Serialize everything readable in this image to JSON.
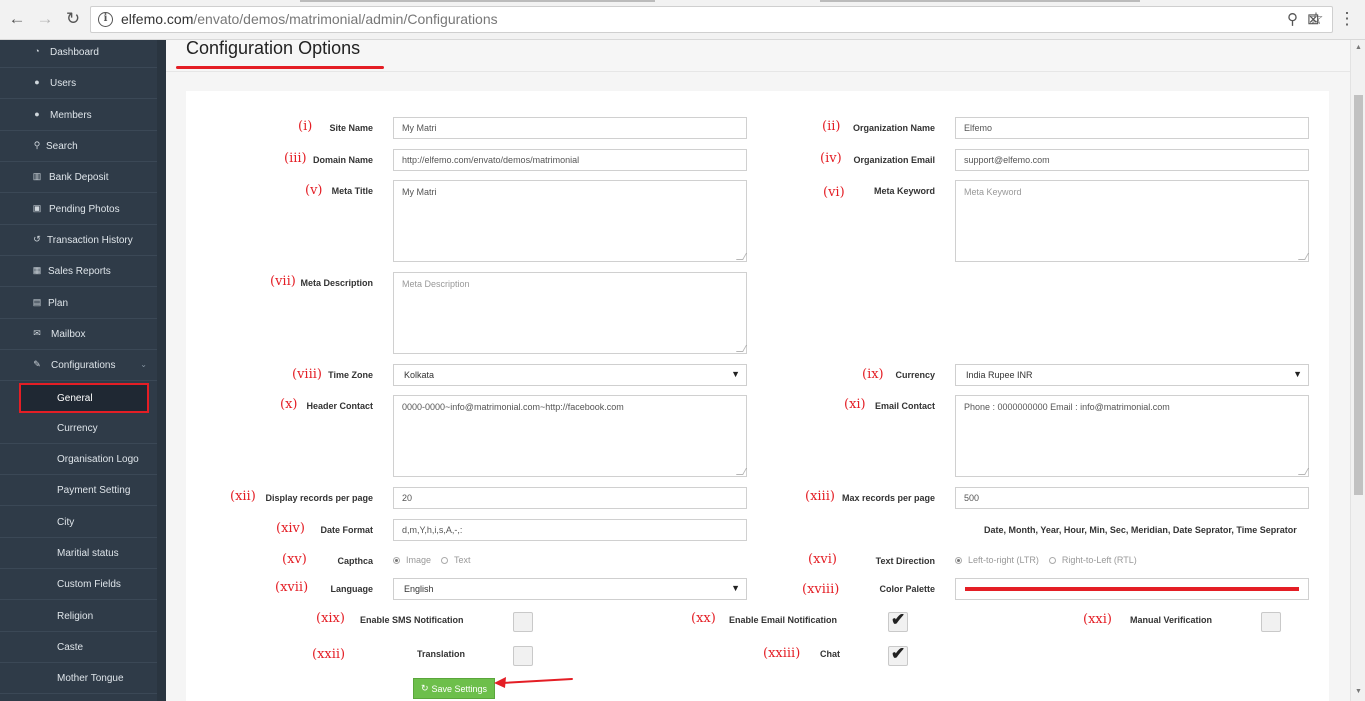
{
  "browser": {
    "url_host": "elfemo.com",
    "url_path": "/envato/demos/matrimonial/admin/Configurations",
    "back_icon": "←",
    "forward_icon": "→",
    "reload_icon": "↻",
    "info_icon": "i",
    "zoom_icon": "⚲",
    "translate_icon": "⊠",
    "star_icon": "☆",
    "menu_icon": "⋮"
  },
  "sidebar": {
    "items": [
      {
        "icon": "◔",
        "label": "Dashboard"
      },
      {
        "icon": "●",
        "label": "Users"
      },
      {
        "icon": "●",
        "label": "Members"
      },
      {
        "icon": "⚲",
        "label": "Search"
      },
      {
        "icon": "▥",
        "label": "Bank Deposit"
      },
      {
        "icon": "▣",
        "label": "Pending Photos"
      },
      {
        "icon": "↺",
        "label": "Transaction History"
      },
      {
        "icon": "▦",
        "label": "Sales Reports"
      },
      {
        "icon": "▤",
        "label": "Plan"
      },
      {
        "icon": "✉",
        "label": "Mailbox"
      },
      {
        "icon": "✎",
        "label": "Configurations"
      }
    ],
    "config_chevron": "⌄",
    "sub_items": [
      "General",
      "Currency",
      "Organisation Logo",
      "Payment Setting",
      "City",
      "Maritial status",
      "Custom Fields",
      "Religion",
      "Caste",
      "Mother Tongue"
    ]
  },
  "page": {
    "title": "Configuration Options"
  },
  "form": {
    "site_name": {
      "num": "(i)",
      "label": "Site Name",
      "value": "My Matri"
    },
    "org_name": {
      "num": "(ii)",
      "label": "Organization Name",
      "value": "Elfemo"
    },
    "domain_name": {
      "num": "(iii)",
      "label": "Domain Name",
      "value": "http://elfemo.com/envato/demos/matrimonial"
    },
    "org_email": {
      "num": "(iv)",
      "label": "Organization Email",
      "value": "support@elfemo.com"
    },
    "meta_title": {
      "num": "(v)",
      "label": "Meta Title",
      "value": "My Matri"
    },
    "meta_keyword": {
      "num": "(vi)",
      "label": "Meta Keyword",
      "placeholder": "Meta Keyword"
    },
    "meta_desc": {
      "num": "(vii)",
      "label": "Meta Description",
      "placeholder": "Meta Description"
    },
    "time_zone": {
      "num": "(viii)",
      "label": "Time Zone",
      "value": "Kolkata"
    },
    "currency": {
      "num": "(ix)",
      "label": "Currency",
      "value": "India Rupee INR"
    },
    "header_contact": {
      "num": "(x)",
      "label": "Header Contact",
      "value": "0000-0000~info@matrimonial.com~http://facebook.com"
    },
    "email_contact": {
      "num": "(xi)",
      "label": "Email Contact",
      "value": "Phone : 0000000000 Email : info@matrimonial.com"
    },
    "display_records": {
      "num": "(xii)",
      "label": "Display records per page",
      "value": "20"
    },
    "max_records": {
      "num": "(xiii)",
      "label": "Max records per page",
      "value": "500"
    },
    "date_format": {
      "num": "(xiv)",
      "label": "Date Format",
      "value": "d,m,Y,h,i,s,A,-,:",
      "hint": "Date, Month, Year, Hour, Min, Sec, Meridian, Date Seprator, Time Seprator"
    },
    "captcha": {
      "num": "(xv)",
      "label": "Capthca",
      "opt1": "Image",
      "opt2": "Text"
    },
    "text_direction": {
      "num": "(xvi)",
      "label": "Text Direction",
      "opt1": "Left-to-right (LTR)",
      "opt2": "Right-to-Left (RTL)"
    },
    "language": {
      "num": "(xvii)",
      "label": "Language",
      "value": "English"
    },
    "color_palette": {
      "num": "(xviii)",
      "label": "Color Palette",
      "color": "#e41e25"
    },
    "sms_notification": {
      "num": "(xix)",
      "label": "Enable SMS Notification",
      "checked": false
    },
    "email_notification": {
      "num": "(xx)",
      "label": "Enable Email Notification",
      "checked": true
    },
    "manual_verification": {
      "num": "(xxi)",
      "label": "Manual Verification",
      "checked": false
    },
    "translation": {
      "num": "(xxii)",
      "label": "Translation",
      "checked": false
    },
    "chat": {
      "num": "(xxiii)",
      "label": "Chat",
      "checked": true
    },
    "save_label": "Save Settings",
    "save_icon": "↻",
    "select_arrow": "▼",
    "check_mark": "✔"
  },
  "colors": {
    "accent": "#e41e25",
    "sidebar": "#2f3b48",
    "save": "#6dbf4b"
  }
}
